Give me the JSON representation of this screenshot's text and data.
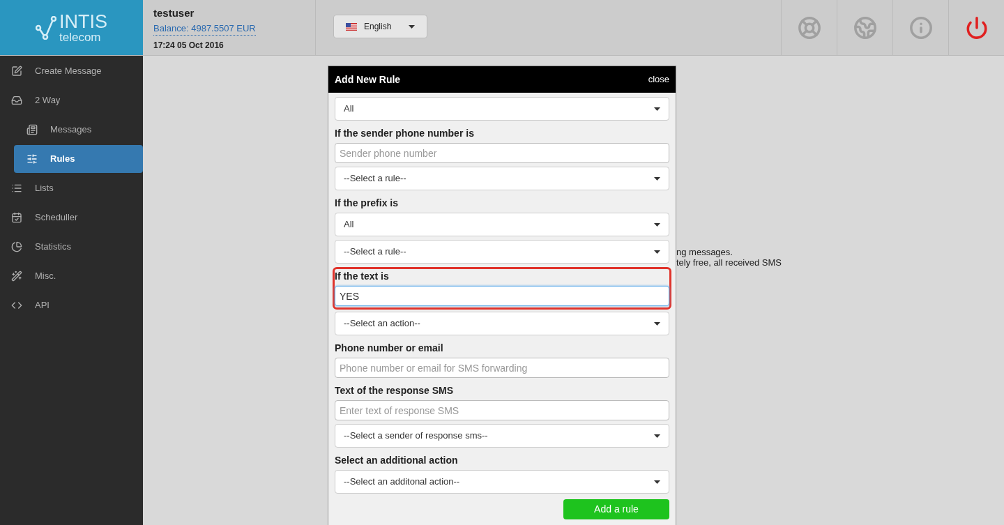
{
  "logo": {
    "name": "INTIS",
    "sub": "telecom"
  },
  "account": {
    "user": "testuser",
    "balance": "Balance: 4987.5507 EUR",
    "datetime": "17:24 05 Oct 2016"
  },
  "language": {
    "value": "English"
  },
  "sidebar": {
    "items": [
      {
        "label": "Create Message",
        "selected": false
      },
      {
        "label": "2 Way",
        "selected": false,
        "children": [
          {
            "label": "Messages",
            "selected": false
          },
          {
            "label": "Rules",
            "selected": true
          }
        ]
      },
      {
        "label": "Lists",
        "selected": false
      },
      {
        "label": "Scheduller",
        "selected": false
      },
      {
        "label": "Statistics",
        "selected": false
      },
      {
        "label": "Misc.",
        "selected": false
      },
      {
        "label": "API",
        "selected": false
      }
    ]
  },
  "background_text": [
    "ng messages.",
    "tely free, all received SMS"
  ],
  "modal": {
    "title": "Add New Rule",
    "close": "close",
    "fields": [
      {
        "kind": "select",
        "value": "All"
      },
      {
        "kind": "input",
        "label": "If the sender phone number is",
        "placeholder": "Sender phone number"
      },
      {
        "kind": "select",
        "value": "--Select a rule--"
      },
      {
        "kind": "select",
        "label": "If the prefix is",
        "value": "All"
      },
      {
        "kind": "select",
        "value": "--Select a rule--"
      },
      {
        "kind": "input",
        "label": "If the text is",
        "value": "YES",
        "focused": true,
        "highlighted": true
      },
      {
        "kind": "select",
        "value": "--Select an action--"
      },
      {
        "kind": "input",
        "label": "Phone number or email",
        "placeholder": "Phone number or email for SMS forwarding"
      },
      {
        "kind": "input",
        "label": "Text of the response SMS",
        "placeholder": "Enter text of response SMS"
      },
      {
        "kind": "select",
        "value": "--Select a sender of response sms--"
      },
      {
        "kind": "select",
        "label": "Select an additional action",
        "value": "--Select an additonal action--"
      }
    ],
    "submit": "Add a rule"
  }
}
